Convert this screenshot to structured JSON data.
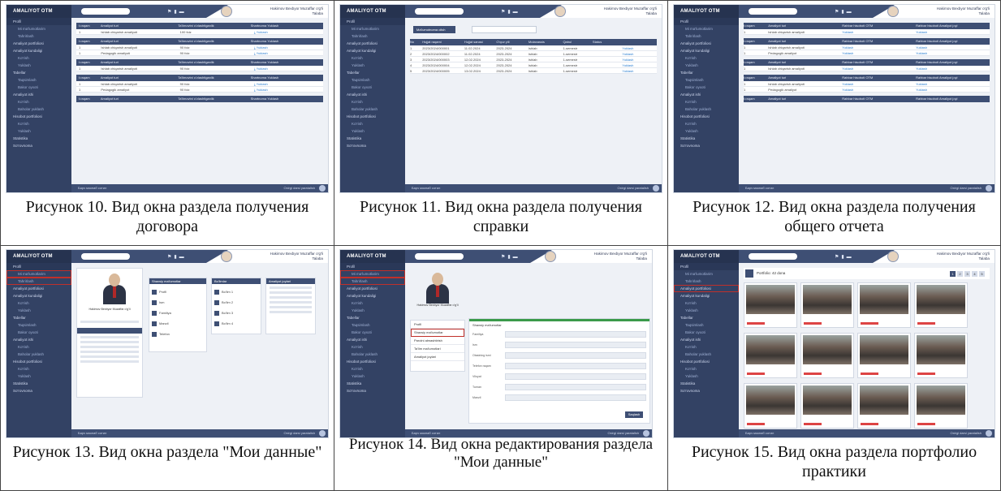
{
  "app": {
    "logo": "AMALIYOT OTM",
    "user_name": "Hakimov Bexbyor Muzaffar o'g'li",
    "user_role": "Talaba",
    "footer_left": "Барч мокнаб сотил",
    "footer_right": "Oxirgi darsi yaratalish"
  },
  "sidebar": [
    {
      "label": "Profil",
      "sub": false
    },
    {
      "label": "Mi ma'lumotlarim",
      "sub": true
    },
    {
      "label": "Tahrirlash",
      "sub": true
    },
    {
      "label": "Amaliyot portfoliosi",
      "sub": false
    },
    {
      "label": "Amaliyot kundaligi",
      "sub": false
    },
    {
      "label": "Ko'rish",
      "sub": true
    },
    {
      "label": "Yuklash",
      "sub": true
    },
    {
      "label": "Tabellar",
      "sub": false
    },
    {
      "label": "Taqsimlash",
      "sub": true
    },
    {
      "label": "Bakor oyxoti",
      "sub": true
    },
    {
      "label": "Amaliyot ishi",
      "sub": false
    },
    {
      "label": "Ko'rish",
      "sub": true
    },
    {
      "label": "Baholar yuklash",
      "sub": true
    },
    {
      "label": "Hisobot portfoliosi",
      "sub": false
    },
    {
      "label": "Ko'rish",
      "sub": true
    },
    {
      "label": "Yuklash",
      "sub": true
    },
    {
      "label": "Statistika",
      "sub": false
    },
    {
      "label": "So'rovnoma",
      "sub": false
    }
  ],
  "fig10": {
    "caption": "Рисунок 10. Вид окна раздела получения договора",
    "header": [
      "t.raqam",
      "Amaliyot turi",
      "Ta'limovtni o'zlashtiganlik",
      "Shartnoma Yuklash"
    ],
    "groups": [
      [
        [
          "1",
          "Ishlab chiqarish amaliyoti",
          "100 foiz",
          "Yuklash"
        ]
      ],
      [
        [
          "1",
          "Ishlab chiqarish amaliyoti",
          "90 foiz",
          "Yuklash"
        ],
        [
          "1",
          "Pedagogik amaliyoti",
          "90 foiz",
          "Yuklash"
        ]
      ],
      [
        [
          "1",
          "Ishlab chiqarish amaliyoti",
          "90 foiz",
          "Yuklash"
        ]
      ],
      [
        [
          "1",
          "Ishlab chiqarish amaliyoti",
          "90 foiz",
          "Yuklash"
        ],
        [
          "1",
          "Pedagogik amaliyot",
          "90 foiz",
          "Yuklash"
        ]
      ],
      []
    ]
  },
  "fig11": {
    "caption": "Рисунок 11. Вид окна раздела получения справки",
    "button": "Ma'lumotnoma olish",
    "header": [
      "No",
      "Hujjat raqami",
      "Hujjat sanasi",
      "O'quv yili",
      "Mutaxassis",
      "Qabul",
      "Status",
      ""
    ],
    "rows": [
      [
        "1",
        "2023/2024/000001",
        "11.02.2024",
        "2023-2024",
        "Ishlab",
        "1-semestr",
        "",
        "Yuklash"
      ],
      [
        "2",
        "2023/2024/000002",
        "11.02.2024",
        "2023-2024",
        "Ishlab",
        "1-semestr",
        "",
        "Yuklash"
      ],
      [
        "3",
        "2023/2024/000003",
        "12.02.2024",
        "2023-2024",
        "Ishlab",
        "1-semestr",
        "",
        "Yuklash"
      ],
      [
        "4",
        "2023/2024/000004",
        "12.02.2024",
        "2023-2024",
        "Ishlab",
        "1-semestr",
        "",
        "Yuklash"
      ],
      [
        "5",
        "2023/2024/000005",
        "13.02.2024",
        "2023-2024",
        "Ishlab",
        "1-semestr",
        "",
        "Yuklash"
      ]
    ]
  },
  "fig12": {
    "caption": "Рисунок 12. Вид окна раздела получения общего отчета",
    "header": [
      "t.raqam",
      "Amaliyot turi",
      "Rahbar hisoboti OTM",
      "Rahbar hisoboti Amaliyot joyi"
    ],
    "groups": [
      [
        [
          "1",
          "Ishlab chiqarish amaliyoti",
          "Yuklash",
          "Yuklash"
        ]
      ],
      [
        [
          "1",
          "Ishlab chiqarish amaliyoti",
          "Yuklash",
          "Yuklash"
        ],
        [
          "1",
          "Pedagogik amaliyot",
          "Yuklash",
          "Yuklash"
        ]
      ],
      [
        [
          "1",
          "Ishlab chiqarish amaliyoti",
          "Yuklash",
          "Yuklash"
        ]
      ],
      [
        [
          "1",
          "Ishlab chiqarish amaliyoti",
          "Yuklash",
          "Yuklash"
        ],
        [
          "1",
          "Pedagogik amaliyot",
          "Yuklash",
          "Yuklash"
        ]
      ],
      []
    ]
  },
  "fig13": {
    "caption": "Рисунок 13. Вид окна раздела \"Мои данные\"",
    "card_titles": [
      "Shaxsiy ma'lumotlar",
      "Bo'limlar",
      "Amaliyot joylari"
    ],
    "profile_name": "Hakimov Bexbyor Muzaffar o'g'li"
  },
  "fig14": {
    "caption": "Рисунок 14. Вид окна редактирования раздела \"Мои данные\"",
    "form_title": "Shaxsiy ma'lumotlar",
    "fields": [
      "Familiya",
      "Ism",
      "Otasining ismi",
      "Telefon raqam",
      "Viloyat",
      "Tuman",
      "Manzil"
    ],
    "menu": [
      "Profil",
      "Shaxsiy ma'lumotlar",
      "Parolni almashtirish",
      "Ta'lim ma'lumotlari",
      "Amaliyot joylari"
    ],
    "save": "Saqlash"
  },
  "fig15": {
    "caption": "Рисунок 15. Вид окна раздела портфолио практики",
    "title": "Portfolio: 42 dona",
    "pager": [
      "1",
      "2",
      "3",
      "4",
      "5"
    ]
  }
}
